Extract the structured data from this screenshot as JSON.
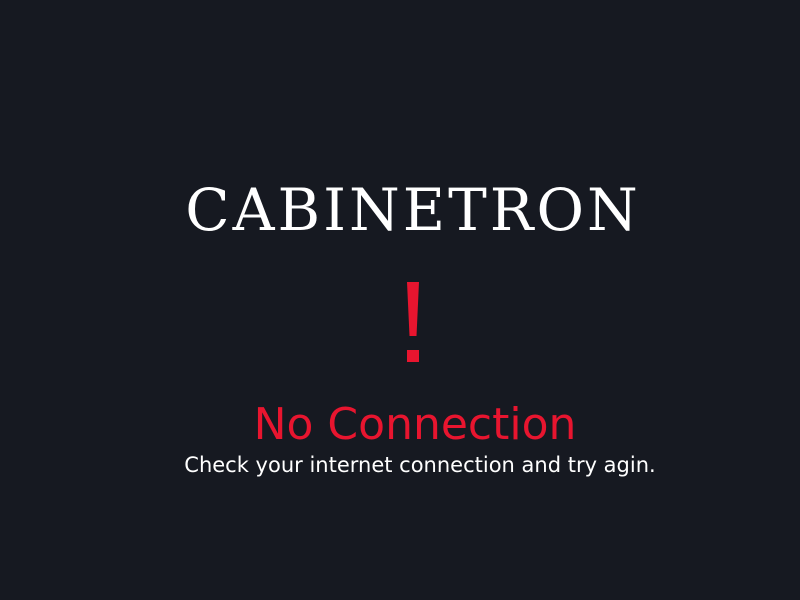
{
  "app": {
    "brand": "CABINETRON"
  },
  "error": {
    "icon": "exclamation-icon",
    "accent_color": "#e8152f",
    "title": "No Connection",
    "message": "Check your internet connection and try agin."
  },
  "theme": {
    "background": "#161921",
    "text": "#ffffff"
  }
}
